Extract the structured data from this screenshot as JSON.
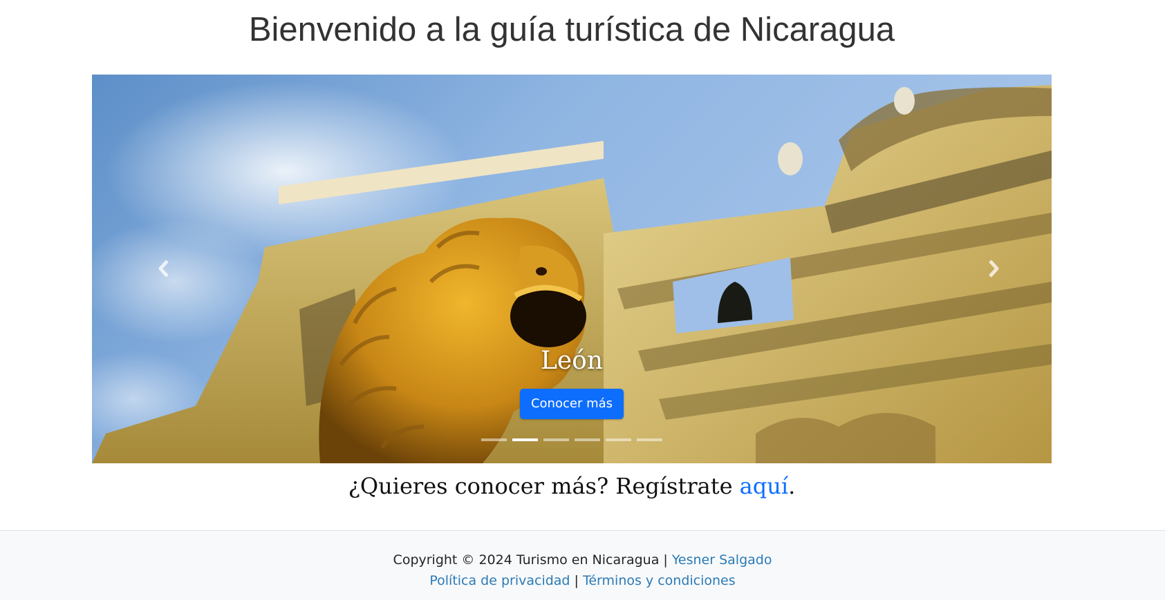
{
  "page": {
    "title": "Bienvenido a la guía turística de Nicaragua"
  },
  "carousel": {
    "caption_title": "León",
    "cta_label": "Conocer más",
    "prev_icon": "chevron-left-icon",
    "next_icon": "chevron-right-icon",
    "slide_count": 6,
    "active_index": 1
  },
  "register": {
    "prefix": "¿Quieres conocer más? Regístrate ",
    "link": "aquí",
    "suffix": "."
  },
  "footer": {
    "copyright": "Copyright © 2024 Turismo en Nicaragua",
    "separator": " | ",
    "author": "Yesner Salgado",
    "privacy": "Política de privacidad",
    "terms": "Términos y condiciones"
  },
  "colors": {
    "primary": "#0d6efd",
    "footer_bg": "#f8f9fa",
    "footer_link": "#2a7ab7",
    "title_text": "#333333"
  }
}
